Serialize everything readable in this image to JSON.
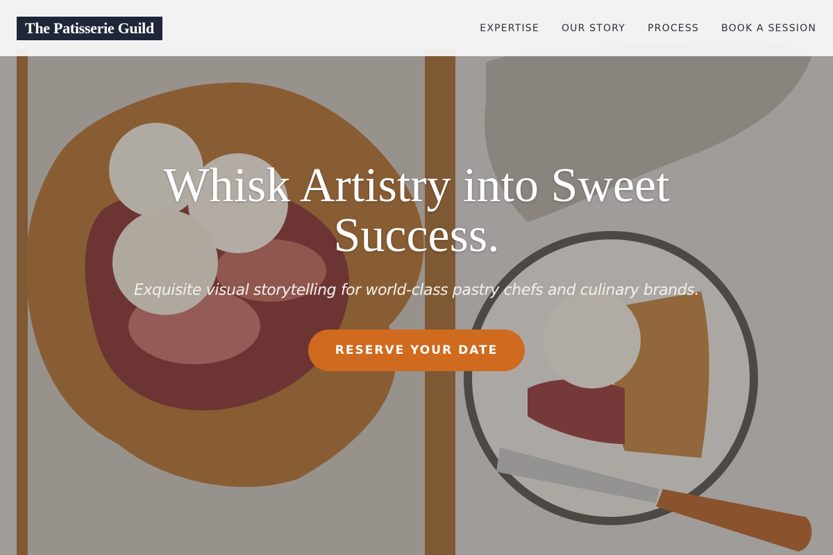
{
  "brand": {
    "name": "The Patisserie Guild"
  },
  "nav": {
    "items": [
      {
        "label": "EXPERTISE"
      },
      {
        "label": "OUR STORY"
      },
      {
        "label": "PROCESS"
      },
      {
        "label": "BOOK A SESSION"
      }
    ]
  },
  "hero": {
    "title": "Whisk Artistry into Sweet Success.",
    "subtitle": "Exquisite visual storytelling for world-class pastry chefs and culinary brands.",
    "cta_label": "RESERVE YOUR DATE"
  },
  "colors": {
    "brand_bg": "#1e2638",
    "accent": "#d06a1f",
    "header_bg": "#fafafa"
  },
  "icons": {
    "hero_image": "pastry-galette-photo"
  }
}
